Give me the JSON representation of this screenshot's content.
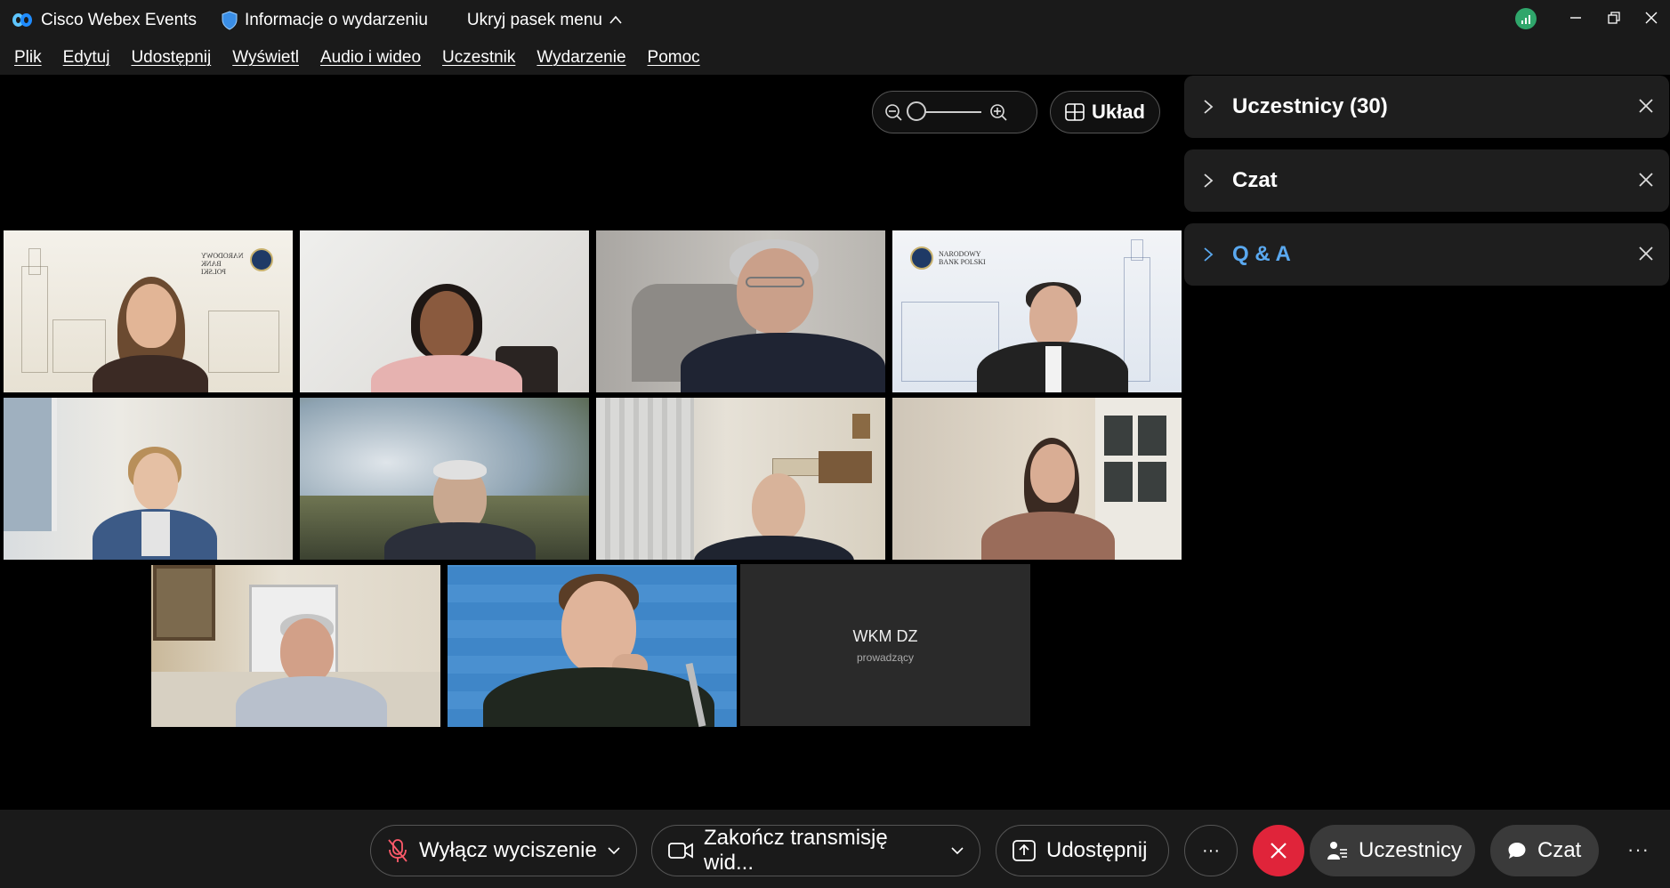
{
  "titlebar": {
    "app_name": "Cisco Webex Events",
    "event_info": "Informacje o wydarzeniu",
    "hide_menu": "Ukryj pasek menu"
  },
  "menubar": {
    "items": [
      "Plik",
      "Edytuj",
      "Udostępnij",
      "Wyświetl",
      "Audio i wideo",
      "Uczestnik",
      "Wydarzenie",
      "Pomoc"
    ]
  },
  "stage": {
    "layout_label": "Układ",
    "name_tile": {
      "name": "WKM DZ",
      "role": "prowadzący"
    },
    "nbp_logo_text": [
      "NARODOWY",
      "BANK POLSKI"
    ]
  },
  "panels": {
    "participants": "Uczestnicy (30)",
    "chat": "Czat",
    "qa": "Q & A"
  },
  "bottombar": {
    "unmute": "Wyłącz wyciszenie",
    "stop_video": "Zakończ transmisję wid...",
    "share": "Udostępnij",
    "more": "···",
    "participants": "Uczestnicy",
    "chat": "Czat",
    "overflow": "···"
  },
  "colors": {
    "accent_blue": "#5aa9f0",
    "leave_red": "#e0243a",
    "signal_green": "#2fa66b"
  }
}
